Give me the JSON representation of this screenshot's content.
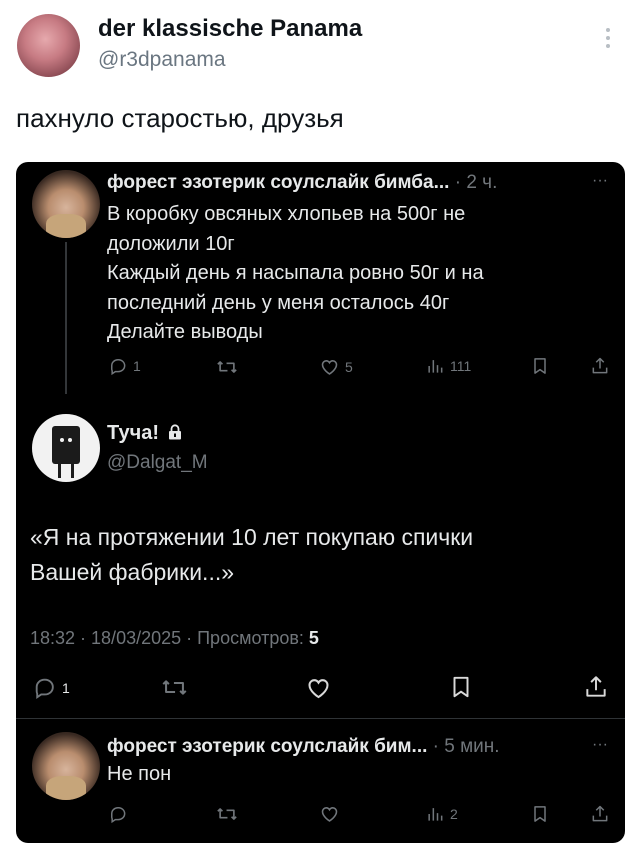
{
  "outer": {
    "name": "der klassische Panama",
    "handle": "@r3dpanama",
    "text": "пахнуло старостью, друзья"
  },
  "tweet1": {
    "name": "форест эзотерик соулслайк бимба...",
    "time": "· 2 ч.",
    "more": "···",
    "lines": [
      "В коробку овсяных хлопьев на 500г не",
      "доложили 10г",
      "Каждый день я насыпала ровно 50г и на",
      "последний день у меня осталось 40г",
      "Делайте выводы"
    ],
    "replies": "1",
    "likes": "5",
    "views": "111"
  },
  "quote": {
    "name": "Туча!",
    "handle": "@Dalgat_M",
    "lines": [
      "«Я на протяжении 10 лет покупаю спички",
      "Вашей фабрики...»"
    ],
    "meta_prefix": "18:32 · 18/03/2025 · Просмотров: ",
    "meta_views": "5",
    "replies": "1"
  },
  "tweet2": {
    "name": "форест эзотерик соулслайк бим...",
    "time": "· 5 мин.",
    "more": "···",
    "text": "Не пон",
    "views": "2"
  },
  "icons": {
    "reply": "reply-icon",
    "retweet": "retweet-icon",
    "like": "heart-icon",
    "views": "bar-chart-icon",
    "bookmark": "bookmark-icon",
    "share": "share-icon",
    "lock": "lock-icon"
  },
  "colors": {
    "text_dark": "#e7e9ea",
    "muted": "#71767b",
    "bg": "#000000"
  }
}
